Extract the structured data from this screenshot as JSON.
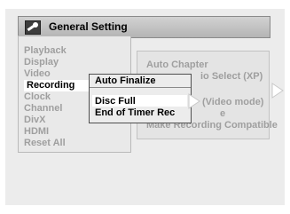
{
  "header": {
    "title": "General Setting",
    "icon": "wrench-icon"
  },
  "main_menu": {
    "items": [
      "Playback",
      "Display",
      "Video",
      "Recording",
      "Clock",
      "Channel",
      "DivX",
      "HDMI",
      "Reset All"
    ],
    "selected": "Recording"
  },
  "recording_submenu": {
    "items": [
      "Auto Chapter",
      "io Select (XP)",
      "(Video mode)",
      "e",
      "Make Recording Compatible"
    ]
  },
  "auto_finalize_popup": {
    "title": "Auto Finalize",
    "options": [
      "Disc Full",
      "End of Timer Rec"
    ],
    "selected": "Disc Full"
  },
  "colors": {
    "background": "#ececec",
    "dimmed_text": "#9f9f9f",
    "highlight": "#ffffff"
  }
}
